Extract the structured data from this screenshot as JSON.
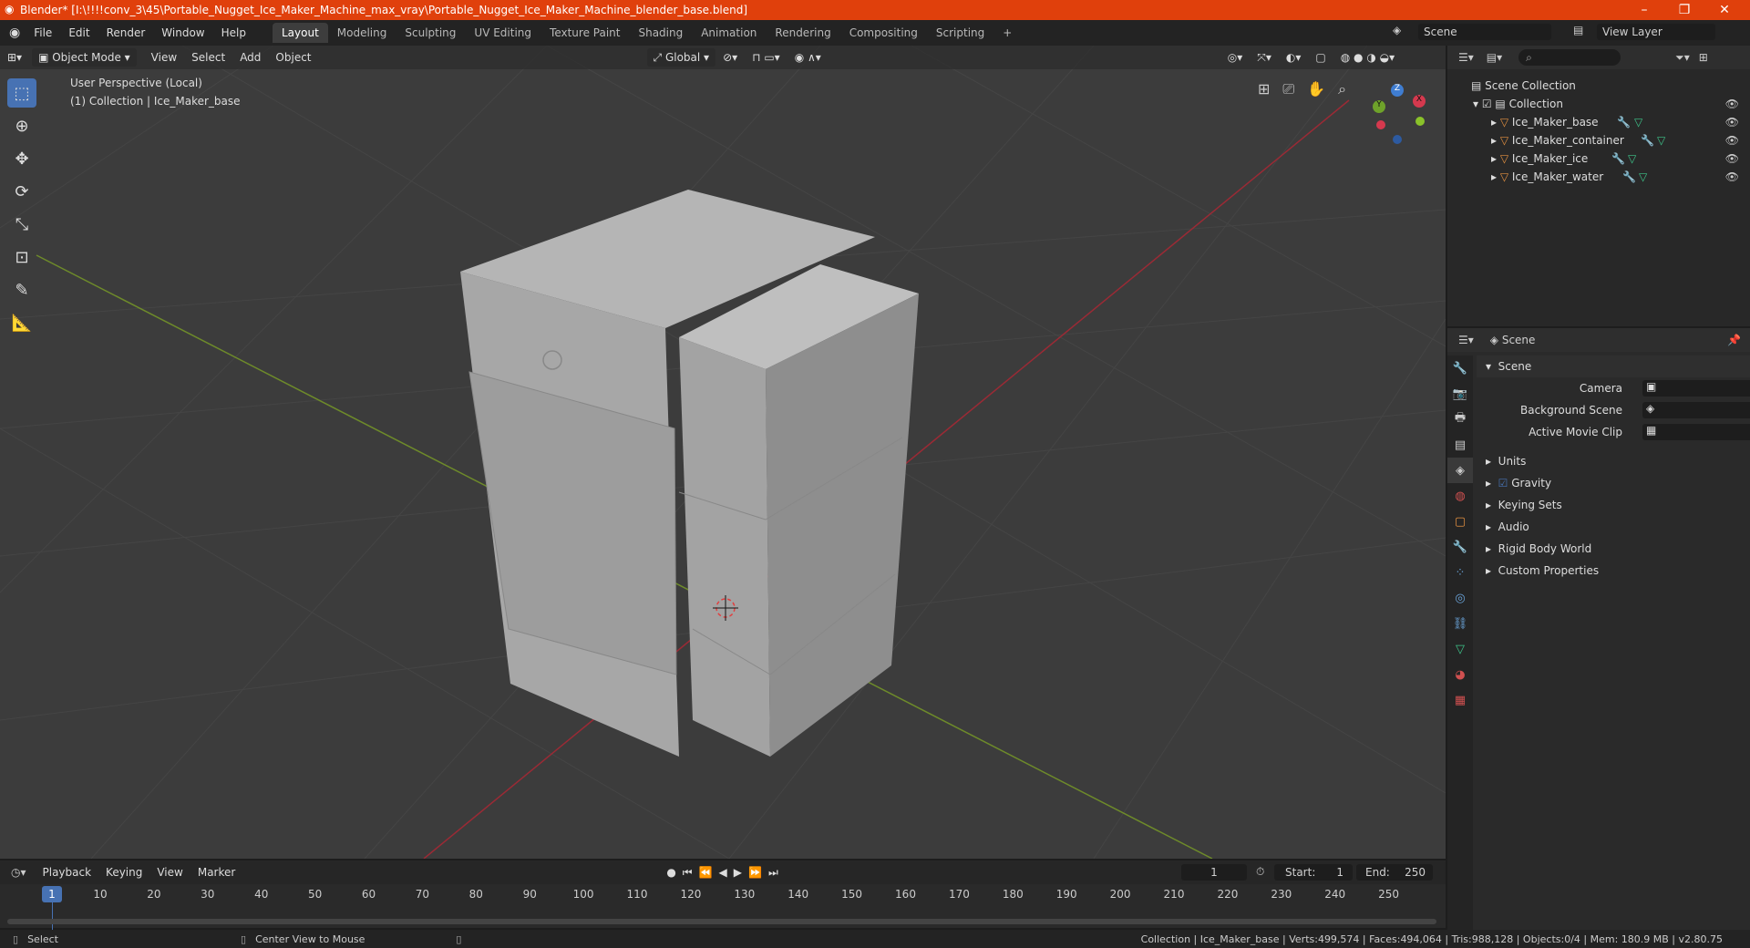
{
  "window": {
    "title": "Blender* [I:\\!!!!conv_3\\45\\Portable_Nugget_Ice_Maker_Machine_max_vray\\Portable_Nugget_Ice_Maker_Machine_blender_base.blend]",
    "minimize": "–",
    "restore": "❐",
    "close": "✕"
  },
  "menu": [
    "File",
    "Edit",
    "Render",
    "Window",
    "Help"
  ],
  "workspaces": [
    "Layout",
    "Modeling",
    "Sculpting",
    "UV Editing",
    "Texture Paint",
    "Shading",
    "Animation",
    "Rendering",
    "Compositing",
    "Scripting"
  ],
  "workspace_add": "+",
  "scene_name": "Scene",
  "view_layer": "View Layer",
  "viewport_header": {
    "mode": "Object Mode",
    "menus": [
      "View",
      "Select",
      "Add",
      "Object"
    ],
    "orientation": "Global"
  },
  "viewport_info": {
    "line1": "User Perspective (Local)",
    "line2": "(1) Collection | Ice_Maker_base"
  },
  "gizmo": {
    "x": "X",
    "y": "Y",
    "z": "Z"
  },
  "outliner": {
    "root": "Scene Collection",
    "collection": "Collection",
    "objects": [
      "Ice_Maker_base",
      "Ice_Maker_container",
      "Ice_Maker_ice",
      "Ice_Maker_water"
    ]
  },
  "properties": {
    "header": "Scene",
    "panel": "Scene",
    "camera_label": "Camera",
    "background_label": "Background Scene",
    "movieclip_label": "Active Movie Clip",
    "subpanels": [
      "Units",
      "Gravity",
      "Keying Sets",
      "Audio",
      "Rigid Body World",
      "Custom Properties"
    ]
  },
  "timeline": {
    "menus": [
      "Playback",
      "Keying",
      "View",
      "Marker"
    ],
    "current_frame": "1",
    "start_label": "Start:",
    "start": "1",
    "end_label": "End:",
    "end": "250",
    "ticks": [
      "1",
      "10",
      "20",
      "30",
      "40",
      "50",
      "60",
      "70",
      "80",
      "90",
      "100",
      "110",
      "120",
      "130",
      "140",
      "150",
      "160",
      "170",
      "180",
      "190",
      "200",
      "210",
      "220",
      "230",
      "240",
      "250"
    ]
  },
  "status": {
    "select": "Select",
    "center": "Center View to Mouse",
    "info": "Collection | Ice_Maker_base | Verts:499,574 | Faces:494,064 | Tris:988,128 | Objects:0/4 | Mem: 180.9 MB | v2.80.75"
  },
  "colors": {
    "accent": "#4772b3",
    "titlebar": "#e0400c",
    "x_axis": "#9b2a35",
    "y_axis": "#7a9a2a"
  }
}
